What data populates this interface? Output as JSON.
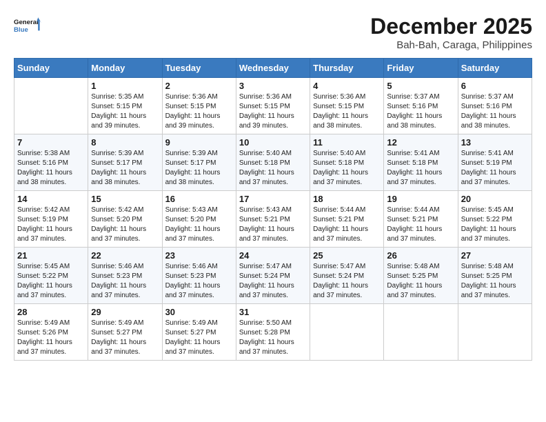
{
  "header": {
    "logo": "GeneralBlue",
    "title": "December 2025",
    "subtitle": "Bah-Bah, Caraga, Philippines"
  },
  "weekdays": [
    "Sunday",
    "Monday",
    "Tuesday",
    "Wednesday",
    "Thursday",
    "Friday",
    "Saturday"
  ],
  "weeks": [
    [
      {
        "day": null
      },
      {
        "day": 1,
        "sunrise": "5:35 AM",
        "sunset": "5:15 PM",
        "daylight": "11 hours and 39 minutes."
      },
      {
        "day": 2,
        "sunrise": "5:36 AM",
        "sunset": "5:15 PM",
        "daylight": "11 hours and 39 minutes."
      },
      {
        "day": 3,
        "sunrise": "5:36 AM",
        "sunset": "5:15 PM",
        "daylight": "11 hours and 39 minutes."
      },
      {
        "day": 4,
        "sunrise": "5:36 AM",
        "sunset": "5:15 PM",
        "daylight": "11 hours and 38 minutes."
      },
      {
        "day": 5,
        "sunrise": "5:37 AM",
        "sunset": "5:16 PM",
        "daylight": "11 hours and 38 minutes."
      },
      {
        "day": 6,
        "sunrise": "5:37 AM",
        "sunset": "5:16 PM",
        "daylight": "11 hours and 38 minutes."
      }
    ],
    [
      {
        "day": 7,
        "sunrise": "5:38 AM",
        "sunset": "5:16 PM",
        "daylight": "11 hours and 38 minutes."
      },
      {
        "day": 8,
        "sunrise": "5:39 AM",
        "sunset": "5:17 PM",
        "daylight": "11 hours and 38 minutes."
      },
      {
        "day": 9,
        "sunrise": "5:39 AM",
        "sunset": "5:17 PM",
        "daylight": "11 hours and 38 minutes."
      },
      {
        "day": 10,
        "sunrise": "5:40 AM",
        "sunset": "5:18 PM",
        "daylight": "11 hours and 37 minutes."
      },
      {
        "day": 11,
        "sunrise": "5:40 AM",
        "sunset": "5:18 PM",
        "daylight": "11 hours and 37 minutes."
      },
      {
        "day": 12,
        "sunrise": "5:41 AM",
        "sunset": "5:18 PM",
        "daylight": "11 hours and 37 minutes."
      },
      {
        "day": 13,
        "sunrise": "5:41 AM",
        "sunset": "5:19 PM",
        "daylight": "11 hours and 37 minutes."
      }
    ],
    [
      {
        "day": 14,
        "sunrise": "5:42 AM",
        "sunset": "5:19 PM",
        "daylight": "11 hours and 37 minutes."
      },
      {
        "day": 15,
        "sunrise": "5:42 AM",
        "sunset": "5:20 PM",
        "daylight": "11 hours and 37 minutes."
      },
      {
        "day": 16,
        "sunrise": "5:43 AM",
        "sunset": "5:20 PM",
        "daylight": "11 hours and 37 minutes."
      },
      {
        "day": 17,
        "sunrise": "5:43 AM",
        "sunset": "5:21 PM",
        "daylight": "11 hours and 37 minutes."
      },
      {
        "day": 18,
        "sunrise": "5:44 AM",
        "sunset": "5:21 PM",
        "daylight": "11 hours and 37 minutes."
      },
      {
        "day": 19,
        "sunrise": "5:44 AM",
        "sunset": "5:21 PM",
        "daylight": "11 hours and 37 minutes."
      },
      {
        "day": 20,
        "sunrise": "5:45 AM",
        "sunset": "5:22 PM",
        "daylight": "11 hours and 37 minutes."
      }
    ],
    [
      {
        "day": 21,
        "sunrise": "5:45 AM",
        "sunset": "5:22 PM",
        "daylight": "11 hours and 37 minutes."
      },
      {
        "day": 22,
        "sunrise": "5:46 AM",
        "sunset": "5:23 PM",
        "daylight": "11 hours and 37 minutes."
      },
      {
        "day": 23,
        "sunrise": "5:46 AM",
        "sunset": "5:23 PM",
        "daylight": "11 hours and 37 minutes."
      },
      {
        "day": 24,
        "sunrise": "5:47 AM",
        "sunset": "5:24 PM",
        "daylight": "11 hours and 37 minutes."
      },
      {
        "day": 25,
        "sunrise": "5:47 AM",
        "sunset": "5:24 PM",
        "daylight": "11 hours and 37 minutes."
      },
      {
        "day": 26,
        "sunrise": "5:48 AM",
        "sunset": "5:25 PM",
        "daylight": "11 hours and 37 minutes."
      },
      {
        "day": 27,
        "sunrise": "5:48 AM",
        "sunset": "5:25 PM",
        "daylight": "11 hours and 37 minutes."
      }
    ],
    [
      {
        "day": 28,
        "sunrise": "5:49 AM",
        "sunset": "5:26 PM",
        "daylight": "11 hours and 37 minutes."
      },
      {
        "day": 29,
        "sunrise": "5:49 AM",
        "sunset": "5:27 PM",
        "daylight": "11 hours and 37 minutes."
      },
      {
        "day": 30,
        "sunrise": "5:49 AM",
        "sunset": "5:27 PM",
        "daylight": "11 hours and 37 minutes."
      },
      {
        "day": 31,
        "sunrise": "5:50 AM",
        "sunset": "5:28 PM",
        "daylight": "11 hours and 37 minutes."
      },
      {
        "day": null
      },
      {
        "day": null
      },
      {
        "day": null
      }
    ]
  ],
  "labels": {
    "sunrise": "Sunrise:",
    "sunset": "Sunset:",
    "daylight": "Daylight:"
  }
}
